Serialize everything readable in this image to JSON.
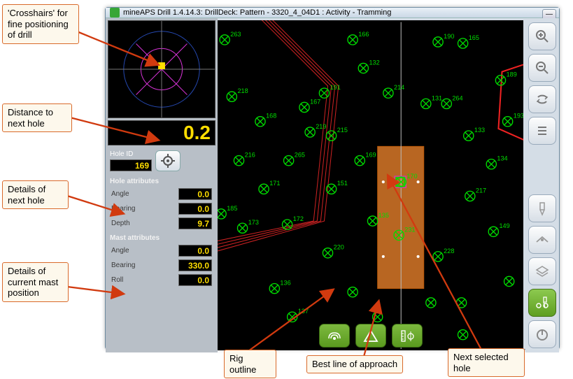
{
  "titlebar": "mineAPS Drill 1.4.14.3: DrillDeck: Pattern - 3320_4_04D1 : Activity - Tramming",
  "callouts": {
    "crosshair": "'Crosshairs' for fine positioning of drill",
    "distance": "Distance to next hole",
    "next_hole": "Details of next hole",
    "mast": "Details of current mast position",
    "rig": "Rig outline",
    "bestline": "Best line of approach",
    "next_sel": "Next selected hole"
  },
  "distance": "0.2",
  "hole_id_label": "Hole ID",
  "hole_id": "169",
  "sections": {
    "hole": "Hole attributes",
    "mast": "Mast attributes"
  },
  "hole_attrs": {
    "angle_l": "Angle",
    "angle_v": "0.0",
    "bearing_l": "Bearing",
    "bearing_v": "0.0",
    "depth_l": "Depth",
    "depth_v": "9.7"
  },
  "mast_attrs": {
    "angle_l": "Angle",
    "angle_v": "0.0",
    "bearing_l": "Bearing",
    "bearing_v": "330.0",
    "roll_l": "Roll",
    "roll_v": "0.0"
  },
  "map_labels": [
    "263",
    "191",
    "165",
    "166",
    "190",
    "132",
    "189",
    "214",
    "218",
    "167",
    "168",
    "131",
    "264",
    "219",
    "215",
    "133",
    "216",
    "170",
    "169",
    "265",
    "217",
    "134",
    "231",
    "171",
    "185",
    "151",
    "172",
    "135",
    "173",
    "220",
    "228",
    "193",
    "136",
    "149",
    "137"
  ]
}
